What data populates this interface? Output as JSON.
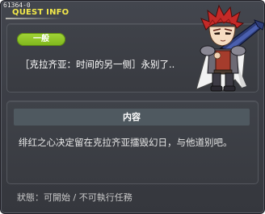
{
  "window": {
    "quest_id": "61364-0",
    "title": "QUEST INFO"
  },
  "summary": {
    "category_label": "一般",
    "quest_name": "［克拉齐亚：时间的另一侧］永别了.."
  },
  "content": {
    "header": "内容",
    "text": "绯红之心决定留在克拉齐亚擂毁幻日，与他道别吧。"
  },
  "status": {
    "text": "狀態：可開始 / 不可執行任務"
  },
  "character": {
    "icon": "npc-warrior-portrait-icon"
  },
  "colors": {
    "title": "#f3e94a",
    "category_pill": "#8bc326",
    "window_bg": "#3d3f46"
  }
}
